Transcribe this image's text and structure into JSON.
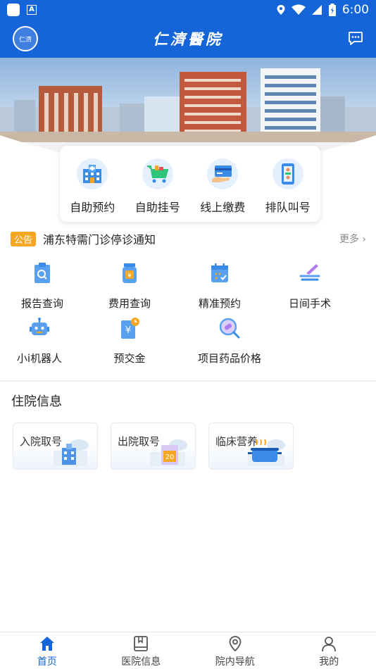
{
  "status_bar": {
    "time": "6:00",
    "a_badge": "A"
  },
  "header": {
    "title": "仁濟醫院",
    "logo_text": "仁濟"
  },
  "quick_actions": [
    {
      "label": "自助预约",
      "icon": "hospital-building-icon"
    },
    {
      "label": "自助挂号",
      "icon": "shopping-cart-icon"
    },
    {
      "label": "线上缴费",
      "icon": "card-payment-icon"
    },
    {
      "label": "排队叫号",
      "icon": "queue-phone-icon"
    }
  ],
  "notice": {
    "tag": "公告",
    "text": "浦东特需门诊停诊通知",
    "more": "更多 ›"
  },
  "services": [
    {
      "label": "报告查询",
      "icon": "report-search-icon"
    },
    {
      "label": "费用查询",
      "icon": "fee-jar-icon"
    },
    {
      "label": "精准预约",
      "icon": "calendar-icon"
    },
    {
      "label": "日间手术",
      "icon": "scalpel-icon"
    },
    {
      "label": "小i机器人",
      "icon": "robot-icon"
    },
    {
      "label": "预交金",
      "icon": "prepay-icon"
    },
    {
      "label": "项目药品价格",
      "icon": "pill-search-icon"
    }
  ],
  "inpatient": {
    "title": "住院信息",
    "cards": [
      {
        "label": "入院取号",
        "icon": "admission-building-icon"
      },
      {
        "label": "出院取号",
        "icon": "discharge-ticket-icon",
        "number": "20"
      },
      {
        "label": "临床营养",
        "icon": "cooking-pot-icon"
      }
    ]
  },
  "tabs": [
    {
      "label": "首页",
      "icon": "home-icon",
      "active": true
    },
    {
      "label": "医院信息",
      "icon": "book-icon",
      "active": false
    },
    {
      "label": "院内导航",
      "icon": "location-pin-icon",
      "active": false
    },
    {
      "label": "我的",
      "icon": "person-icon",
      "active": false
    }
  ],
  "colors": {
    "primary": "#1565d8",
    "notice_tag": "#f5a623",
    "icon_light": "#e4f0fd"
  }
}
